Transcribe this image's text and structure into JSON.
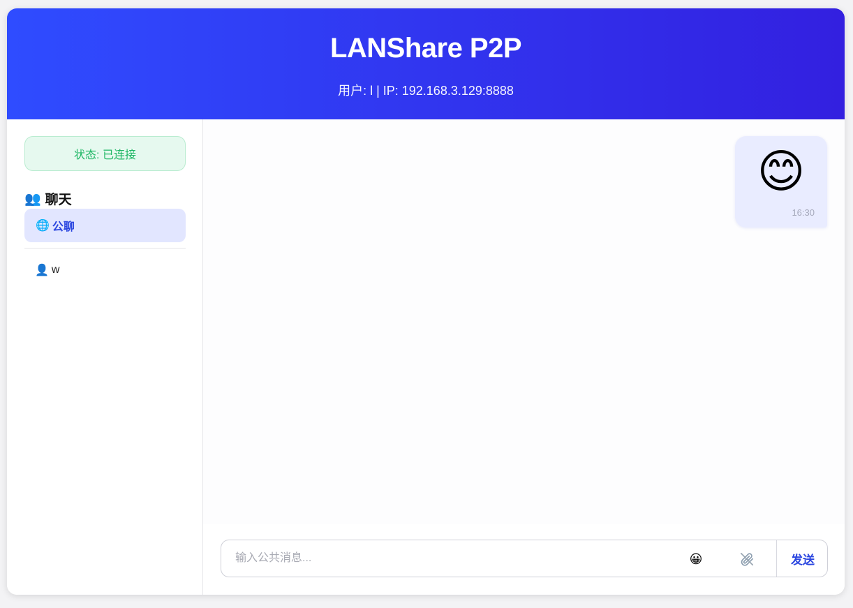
{
  "header": {
    "title": "LANShare P2P",
    "subtitle": "用户: l | IP: 192.168.3.129:8888"
  },
  "sidebar": {
    "status_text": "状态: 已连接",
    "section_icon": "👥",
    "section_title": "聊天",
    "public_chat": {
      "icon": "🌐",
      "label": "公聊"
    },
    "users": [
      {
        "icon": "👤",
        "name": "w"
      }
    ]
  },
  "messages": [
    {
      "content": "😊",
      "time": "16:30",
      "from": "self"
    }
  ],
  "composer": {
    "placeholder": "输入公共消息...",
    "emoji_icon": "😀",
    "attach_icon": "paperclip-icon",
    "send_label": "发送"
  },
  "colors": {
    "header_start": "#2f4cff",
    "header_end": "#3320e0",
    "accent": "#2c47e0",
    "status_ok": "#1fb765",
    "status_bg": "#e6f9ef",
    "bubble_bg": "#e9ecff"
  }
}
